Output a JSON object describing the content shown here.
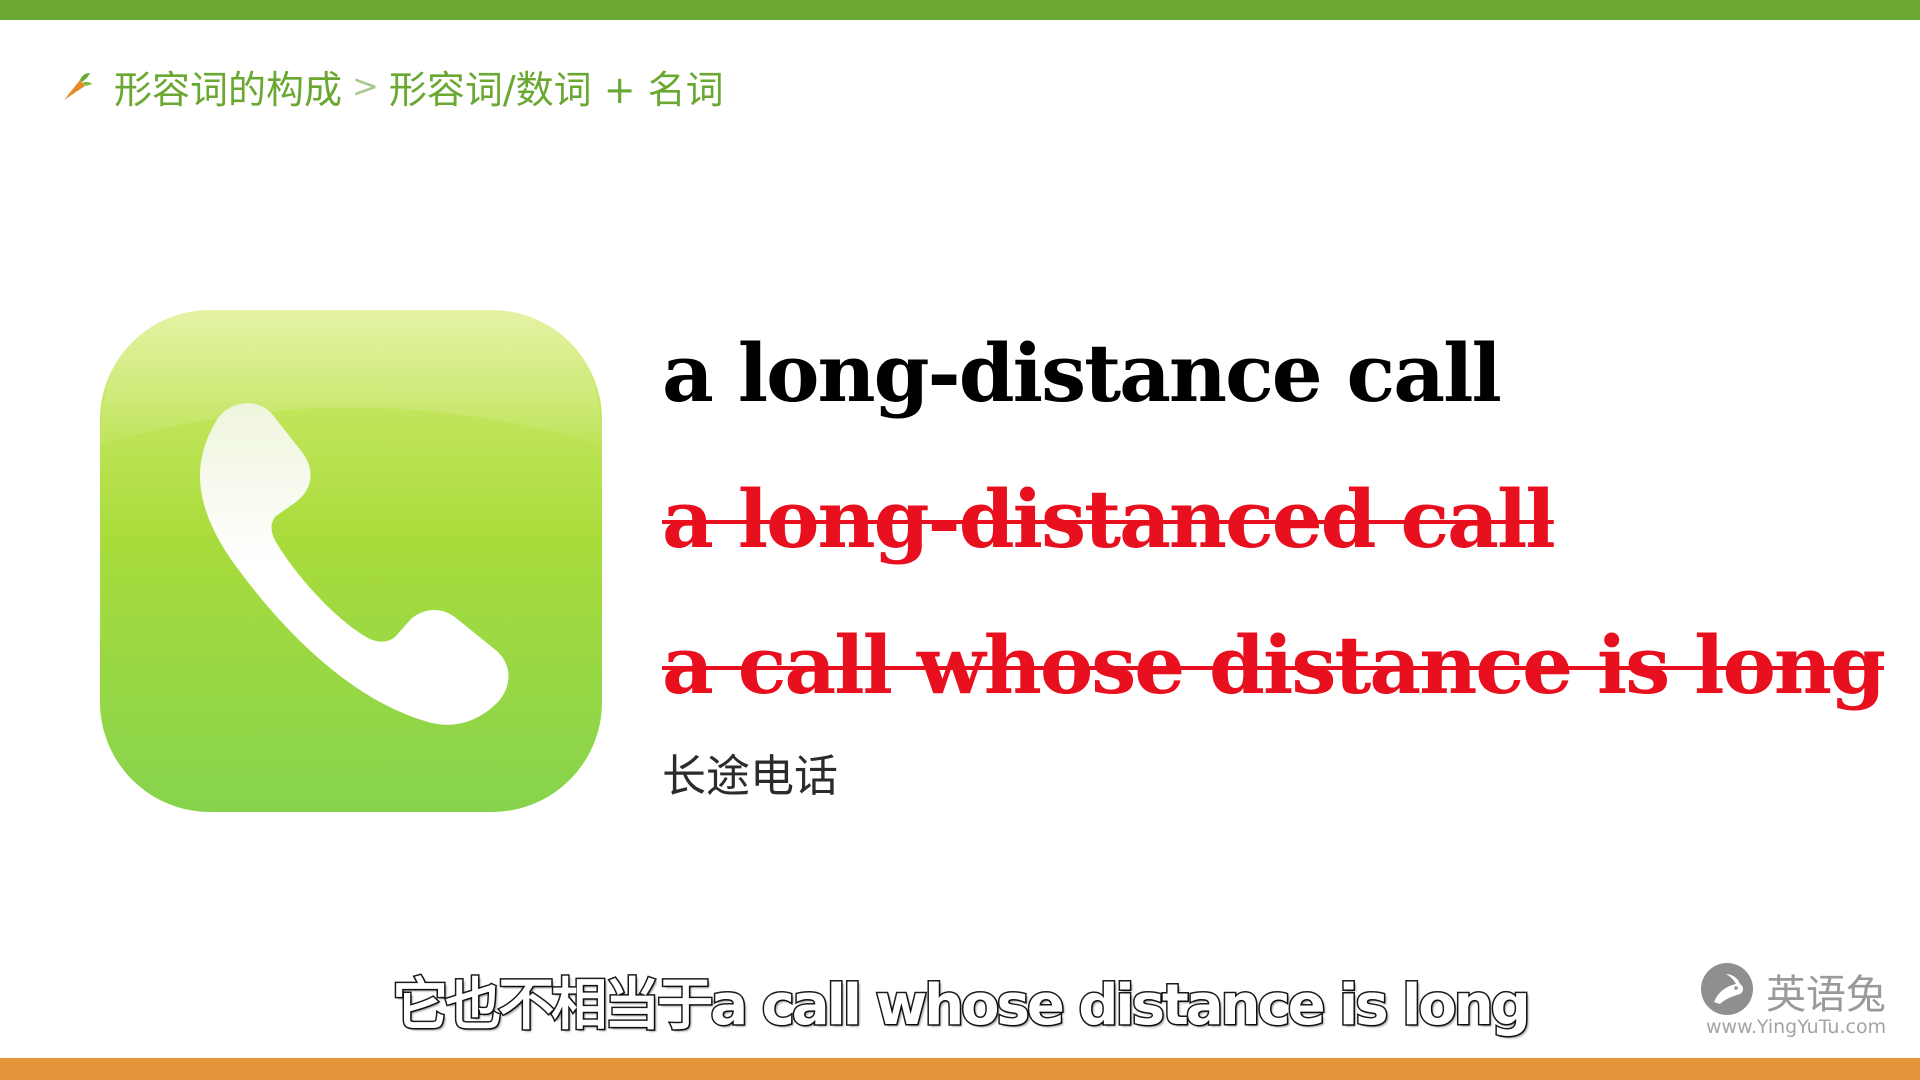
{
  "breadcrumb": {
    "icon": "carrot-icon",
    "parent": "形容词的构成",
    "separator": ">",
    "current": "形容词/数词 + 名词"
  },
  "illustration": {
    "icon": "phone-app-icon",
    "colors": {
      "top": "#d4ec72",
      "bottom": "#86d34a",
      "handset": "#ffffff"
    }
  },
  "examples": [
    {
      "text": "a long-distance call",
      "status": "correct",
      "color": "#000000"
    },
    {
      "text": "a long-distanced call",
      "status": "incorrect",
      "color": "#e8101e"
    },
    {
      "text": "a call whose distance is long",
      "status": "incorrect",
      "color": "#e8101e"
    }
  ],
  "translation": "长途电话",
  "subtitle": "它也不相当于a call whose distance is long",
  "logo": {
    "icon": "rabbit-icon",
    "name": "英语兔",
    "url": "www.YingYuTu.com"
  },
  "colors": {
    "top_bar": "#6aa832",
    "bottom_bar": "#e6963a",
    "breadcrumb_text": "#6aa832",
    "wrong": "#e8101e"
  }
}
